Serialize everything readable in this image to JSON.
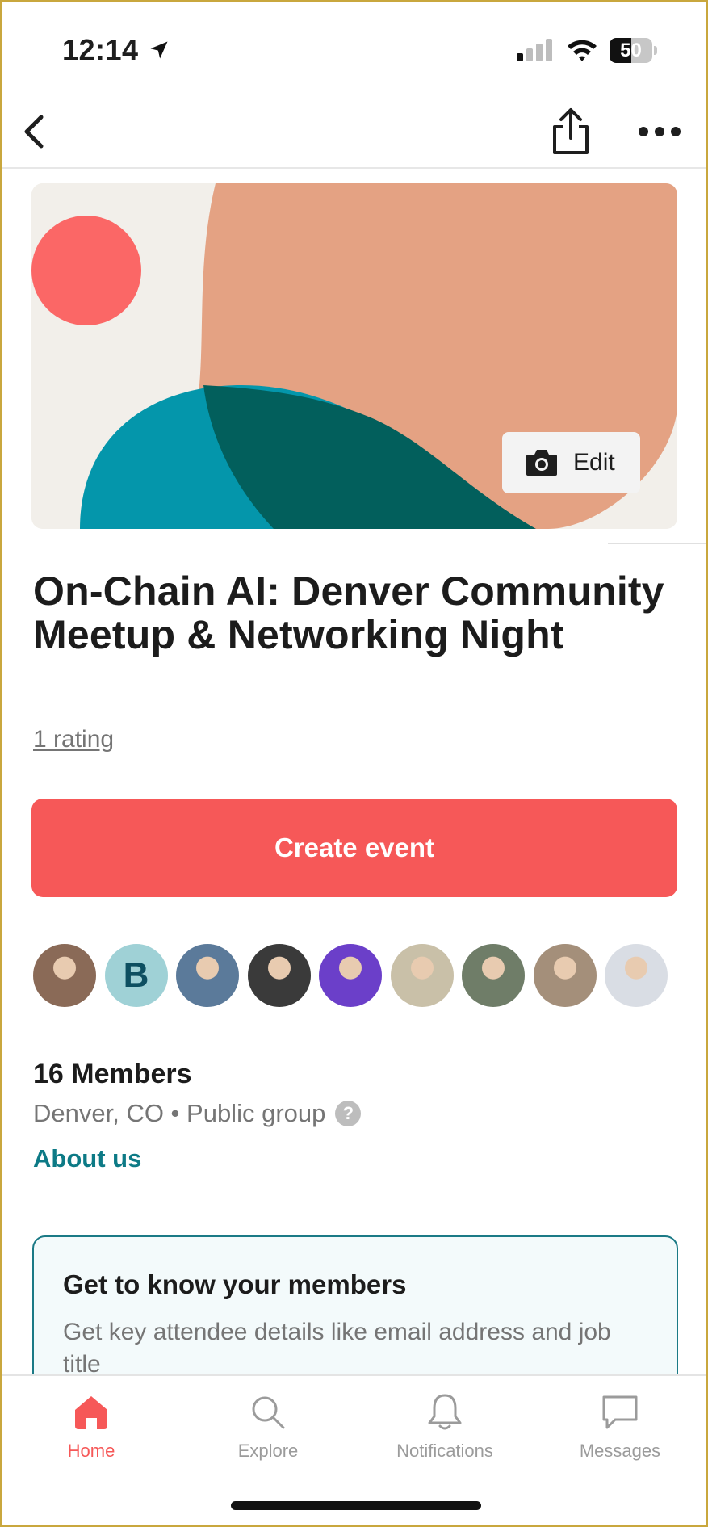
{
  "status_bar": {
    "time": "12:14",
    "battery": "50",
    "battery_level": 0.5
  },
  "nav": {
    "back_icon": "chevron-left-icon",
    "share_icon": "share-icon",
    "more_icon": "more-horizontal-icon"
  },
  "cover": {
    "edit_label": "Edit",
    "edit_icon": "camera-icon",
    "colors": {
      "background": "#f2efea",
      "peach": "#e4a283",
      "coral": "#fb6766",
      "teal": "#0496ab",
      "dark_teal": "#025f5c"
    }
  },
  "group": {
    "title": "On-Chain AI: Denver Community Meetup & Networking Night",
    "rating": "1 rating",
    "create_button": "Create event",
    "members_count": "16 Members",
    "location_and_type": "Denver, CO • Public group",
    "help_icon": "?",
    "about_link": "About us",
    "avatars": [
      {
        "letter": "",
        "color": "#8a6a57"
      },
      {
        "letter": "B",
        "color": "#9fd1d6"
      },
      {
        "letter": "",
        "color": "#5b7a9a"
      },
      {
        "letter": "",
        "color": "#3a3a3a"
      },
      {
        "letter": "",
        "color": "#6b3fc9"
      },
      {
        "letter": "",
        "color": "#c9c0a8"
      },
      {
        "letter": "",
        "color": "#6f7d68"
      },
      {
        "letter": "",
        "color": "#a48f7a"
      },
      {
        "letter": "",
        "color": "#d9dde4"
      }
    ]
  },
  "card": {
    "title": "Get to know your members",
    "text": "Get key attendee details like email address and job title"
  },
  "tabs": [
    {
      "label": "Home",
      "icon": "home-icon",
      "active": true
    },
    {
      "label": "Explore",
      "icon": "search-icon",
      "active": false
    },
    {
      "label": "Notifications",
      "icon": "bell-icon",
      "active": false
    },
    {
      "label": "Messages",
      "icon": "chat-icon",
      "active": false
    }
  ],
  "colors": {
    "accent": "#f65858",
    "link": "#0d7a86",
    "muted": "#757575"
  }
}
